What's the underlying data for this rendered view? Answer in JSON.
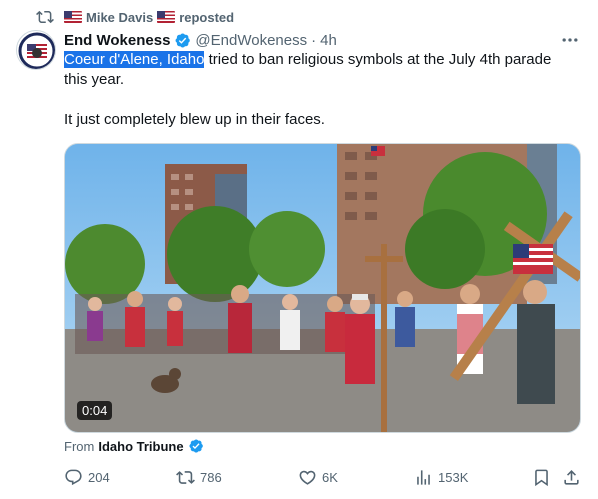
{
  "repost": {
    "user": "Mike Davis",
    "label": "reposted"
  },
  "author": {
    "name": "End Wokeness",
    "handle": "@EndWokeness",
    "separator": "·",
    "time": "4h"
  },
  "tweet": {
    "selected_text": "Coeur d'Alene, Idaho",
    "line1_rest": " tried to ban religious symbols at the July 4th parade this year.",
    "line2": "It just completely blew up in their faces."
  },
  "media": {
    "duration": "0:04"
  },
  "source": {
    "prefix": "From",
    "name": "Idaho Tribune"
  },
  "actions": {
    "replies": "204",
    "reposts": "786",
    "likes": "6K",
    "views": "153K"
  },
  "colors": {
    "text": "#0f1419",
    "secondary": "#536471",
    "verified": "#1d9bf0",
    "selection": "#1a73e8"
  }
}
